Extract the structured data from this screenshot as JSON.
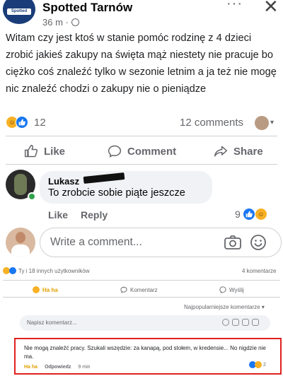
{
  "post": {
    "page_name": "Spotted Tarnów",
    "logo_text": "Spotted",
    "time": "36 m ·",
    "text": "Witam czy jest ktoś w stanie pomóc rodzinę z 4 dzieci zrobić jakieś zakupy na święta mąż niestety nie pracuje bo ciężko coś znaleźć tylko w sezonie letnim a ja też nie mogę nic znaleźć chodzi o zakupy nie o pieniądze",
    "reaction_count": "12",
    "comment_count": "12 comments",
    "actions": {
      "like": "Like",
      "comment": "Comment",
      "share": "Share"
    }
  },
  "comment": {
    "author": "Lukasz",
    "text": "To zrobcie sobie piąte jeszcze",
    "like": "Like",
    "reply": "Reply",
    "reaction_count": "9"
  },
  "write_comment": {
    "placeholder": "Write a comment..."
  },
  "desktop_snippet": {
    "reactions_text": "Ty i 18 innych użytkowników",
    "comments_count": "4 komentarze",
    "actions": {
      "haha": "Ha ha",
      "comment": "Komentarz",
      "share": "Wyślij"
    },
    "sort": "Najpopularniejsze komentarze",
    "input_placeholder": "Napisz komentarz...",
    "highlighted_comment": {
      "text": "Nie mogą znaleźć pracy. Szukali wszędzie: za kanapą, pod stołem, w kredensie... No nigdzie nie ma.",
      "haha": "Ha ha",
      "reply": "Odpowiedz",
      "time": "9 min",
      "reaction_count": "2"
    }
  },
  "colors": {
    "accent": "#1877f2",
    "highlight_border": "#e02020",
    "haha": "#f7b125"
  }
}
